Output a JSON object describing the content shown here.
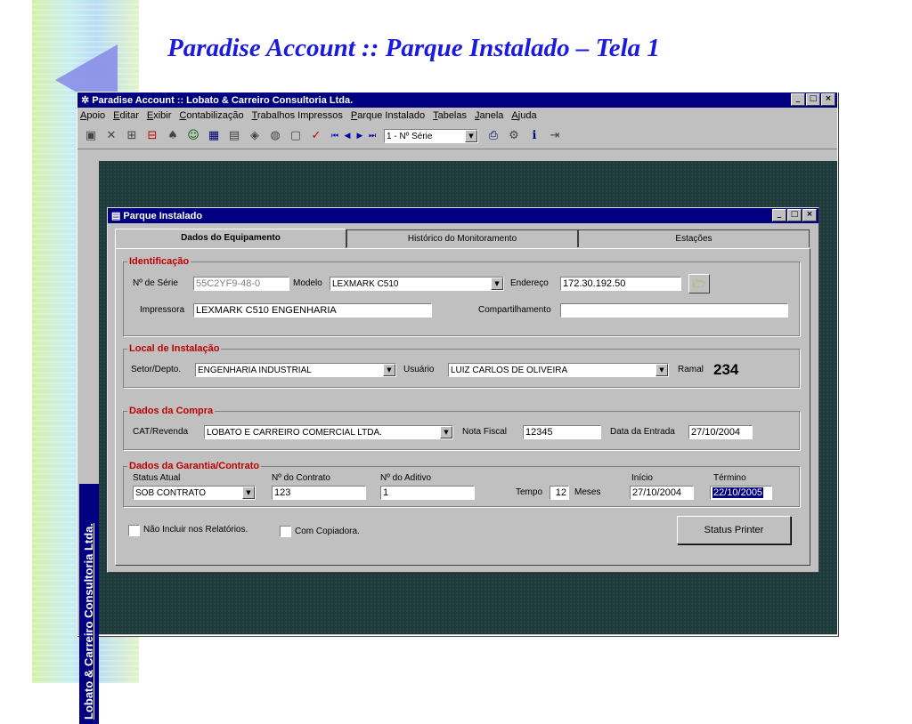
{
  "slide": {
    "title": "Paradise Account :: Parque Instalado – Tela 1"
  },
  "app": {
    "title": "Paradise Account :: Lobato & Carreiro Consultoria Ltda.",
    "vertical_label": "Lobato & Carreiro Consultoria Ltda.",
    "menu": [
      "Apoio",
      "Editar",
      "Exibir",
      "Contabilização",
      "Trabalhos Impressos",
      "Parque Instalado",
      "Tabelas",
      "Janela",
      "Ajuda"
    ],
    "toolbar": {
      "search_combo": "1 - Nº Série"
    },
    "window_buttons": {
      "minimize": "_",
      "maximize": "□",
      "close": "×"
    }
  },
  "child": {
    "title": "Parque Instalado",
    "tabs": [
      "Dados do Equipamento",
      "Histórico do Monitoramento",
      "Estações"
    ],
    "identificacao": {
      "legend": "Identificação",
      "serie_label": "Nº de Série",
      "serie_value": "55C2YF9-48-0",
      "modelo_label": "Modelo",
      "modelo_value": "LEXMARK C510",
      "endereco_label": "Endereço",
      "endereco_value": "172.30.192.50",
      "impressora_label": "Impressora",
      "impressora_value": "LEXMARK C510 ENGENHARIA",
      "compartilhamento_label": "Compartilhamento",
      "compartilhamento_value": ""
    },
    "local": {
      "legend": "Local de Instalação",
      "setor_label": "Setor/Depto.",
      "setor_value": "ENGENHARIA INDUSTRIAL",
      "usuario_label": "Usuário",
      "usuario_value": "LUIZ CARLOS DE OLIVEIRA",
      "ramal_label": "Ramal",
      "ramal_value": "234"
    },
    "compra": {
      "legend": "Dados da Compra",
      "cat_label": "CAT/Revenda",
      "cat_value": "LOBATO E CARREIRO COMERCIAL LTDA.",
      "nota_label": "Nota Fiscal",
      "nota_value": "12345",
      "entrada_label": "Data da Entrada",
      "entrada_value": "27/10/2004"
    },
    "garantia": {
      "legend": "Dados da Garantia/Contrato",
      "status_label": "Status Atual",
      "status_value": "SOB CONTRATO",
      "contrato_label": "Nº do Contrato",
      "contrato_value": "123",
      "aditivo_label": "Nº do Aditivo",
      "aditivo_value": "1",
      "tempo_label": "Tempo",
      "tempo_value": "12",
      "meses_label": "Meses",
      "inicio_label": "Início",
      "inicio_value": "27/10/2004",
      "termino_label": "Término",
      "termino_value": "22/10/2005"
    },
    "footer": {
      "nao_incluir": "Não Incluir nos Relatórios.",
      "com_copiadora": "Com Copiadora.",
      "status_button": "Status Printer"
    }
  }
}
